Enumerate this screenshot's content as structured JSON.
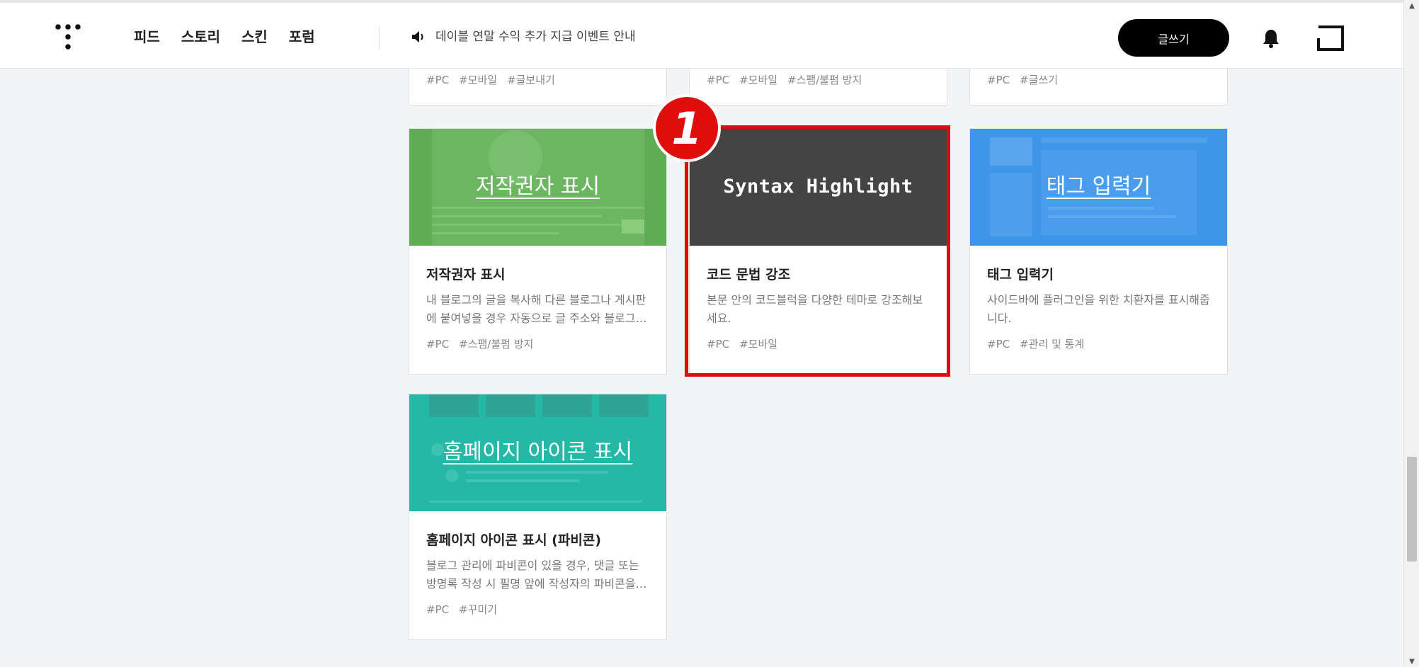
{
  "header": {
    "nav": [
      "피드",
      "스토리",
      "스킨",
      "포럼"
    ],
    "notice": "데이블 연말 수익 추가 지급 이벤트 안내",
    "write_label": "글쓰기"
  },
  "partial_cards": [
    {
      "tags": [
        "#PC",
        "#모바일",
        "#글보내기"
      ]
    },
    {
      "tags": [
        "#PC",
        "#모바일",
        "#스팸/불펌 방지"
      ]
    },
    {
      "tags": [
        "#PC",
        "#글쓰기"
      ]
    }
  ],
  "cards": [
    {
      "thumb_text": "저작권자 표시",
      "title": "저작권자 표시",
      "desc": "내 블로그의 글을 복사해 다른 블로그나 게시판에 붙여넣을 경우 자동으로 글 주소와 블로그…",
      "tags": [
        "#PC",
        "#스팸/불펌 방지"
      ]
    },
    {
      "thumb_text": "Syntax Highlight",
      "title": "코드 문법 강조",
      "desc": "본문 안의 코드블럭을 다양한 테마로 강조해보세요.",
      "tags": [
        "#PC",
        "#모바일"
      ]
    },
    {
      "thumb_text": "태그 입력기",
      "title": "태그 입력기",
      "desc": "사이드바에 플러그인을 위한 치환자를 표시해줍니다.",
      "tags": [
        "#PC",
        "#관리 및 통계"
      ]
    },
    {
      "thumb_text": "홈페이지 아이콘 표시",
      "title": "홈페이지 아이콘 표시 (파비콘)",
      "desc": "블로그 관리에 파비콘이 있을 경우, 댓글 또는 방명록 작성 시 필명 앞에 작성자의 파비콘을…",
      "tags": [
        "#PC",
        "#꾸미기"
      ]
    }
  ],
  "annotation": {
    "badge_number": "1",
    "color": "#e00d0d"
  },
  "colors": {
    "green_thumb": "#5fae53",
    "dark_thumb": "#444444",
    "blue_thumb": "#3f96e8",
    "teal_thumb": "#25b8a6",
    "background": "#f3f4f6"
  }
}
